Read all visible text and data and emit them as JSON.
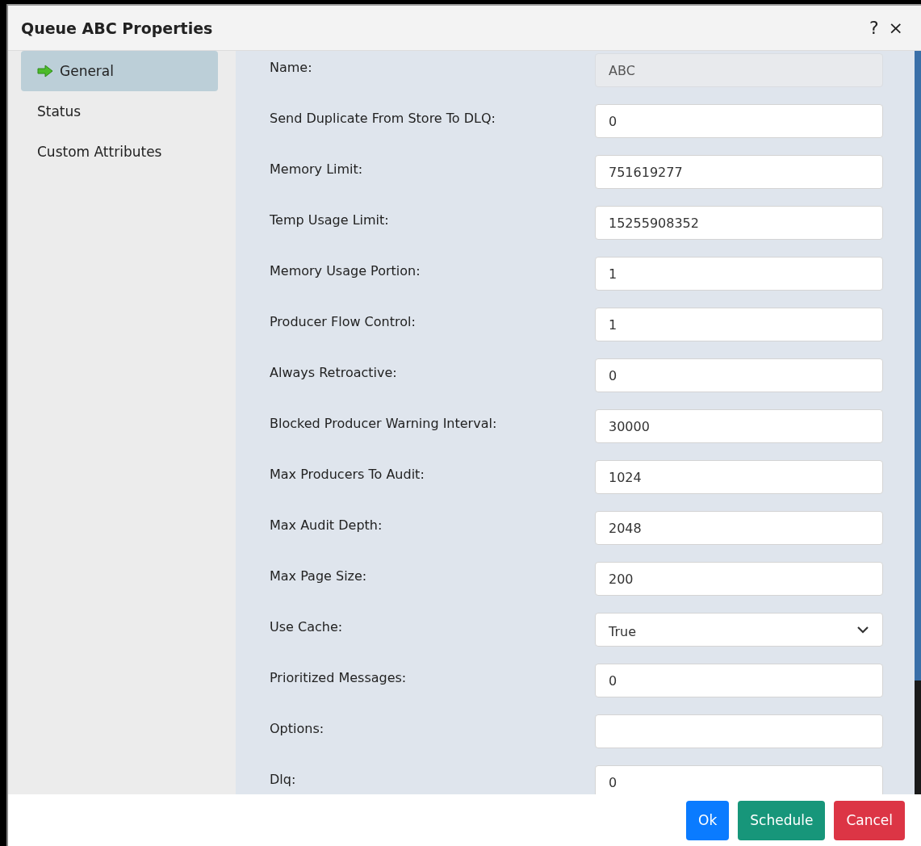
{
  "window": {
    "title": "Queue ABC Properties",
    "help": "?",
    "close": "×"
  },
  "sidebar": {
    "items": [
      {
        "label": "General",
        "selected": true
      },
      {
        "label": "Status",
        "selected": false
      },
      {
        "label": "Custom Attributes",
        "selected": false
      }
    ]
  },
  "fields": [
    {
      "label": "Name:",
      "kind": "text",
      "value": "ABC",
      "disabled": true
    },
    {
      "label": "Send Duplicate From Store To DLQ:",
      "kind": "text",
      "value": "0",
      "disabled": false
    },
    {
      "label": "Memory Limit:",
      "kind": "text",
      "value": "751619277",
      "disabled": false
    },
    {
      "label": "Temp Usage Limit:",
      "kind": "text",
      "value": "15255908352",
      "disabled": false
    },
    {
      "label": "Memory Usage Portion:",
      "kind": "text",
      "value": "1",
      "disabled": false
    },
    {
      "label": "Producer Flow Control:",
      "kind": "text",
      "value": "1",
      "disabled": false
    },
    {
      "label": "Always Retroactive:",
      "kind": "text",
      "value": "0",
      "disabled": false
    },
    {
      "label": "Blocked Producer Warning Interval:",
      "kind": "text",
      "value": "30000",
      "disabled": false
    },
    {
      "label": "Max Producers To Audit:",
      "kind": "text",
      "value": "1024",
      "disabled": false
    },
    {
      "label": "Max Audit Depth:",
      "kind": "text",
      "value": "2048",
      "disabled": false
    },
    {
      "label": "Max Page Size:",
      "kind": "text",
      "value": "200",
      "disabled": false
    },
    {
      "label": "Use Cache:",
      "kind": "select",
      "value": "True",
      "disabled": false
    },
    {
      "label": "Prioritized Messages:",
      "kind": "text",
      "value": "0",
      "disabled": false
    },
    {
      "label": "Options:",
      "kind": "text",
      "disabled": false
    },
    {
      "label": "Dlq:",
      "kind": "text",
      "value": "0",
      "disabled": false
    }
  ],
  "buttons": [
    {
      "label": "Ok",
      "kind": "primary"
    },
    {
      "label": "Schedule",
      "kind": "success"
    },
    {
      "label": "Cancel",
      "kind": "danger"
    }
  ]
}
